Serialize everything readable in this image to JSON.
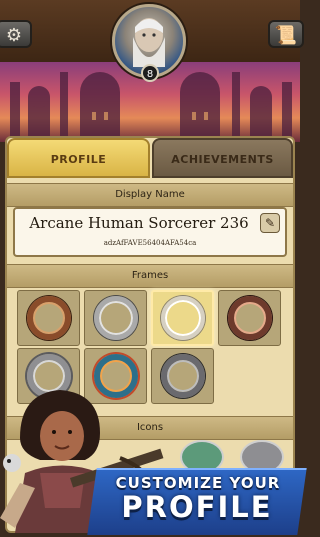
{
  "header": {
    "settings_icon": "gear-icon",
    "scroll_icon": "scroll-icon",
    "player_level": "8"
  },
  "tabs": [
    {
      "label": "PROFILE",
      "active": true
    },
    {
      "label": "ACHIEVEMENTS",
      "active": false
    }
  ],
  "display_name_section": {
    "header": "Display Name",
    "name": "Arcane Human Sorcerer 236",
    "player_id": "adzAfFAVE56404AFA54ca",
    "edit_icon": "pencil-icon"
  },
  "frames_section": {
    "header": "Frames",
    "frames": [
      {
        "style": "copper"
      },
      {
        "style": "silver"
      },
      {
        "style": "gold",
        "selected": true
      },
      {
        "style": "rose"
      },
      {
        "style": "ornate-silver"
      },
      {
        "style": "gem"
      },
      {
        "style": "dark-silver"
      }
    ]
  },
  "icons_section": {
    "header": "Icons"
  },
  "promo": {
    "line1": "CUSTOMIZE YOUR",
    "line2": "PROFILE"
  },
  "colors": {
    "panel": "#ecdcae",
    "active_tab": "#f4da76",
    "inactive_tab": "#7a6a52",
    "banner": "#2e67c4"
  }
}
